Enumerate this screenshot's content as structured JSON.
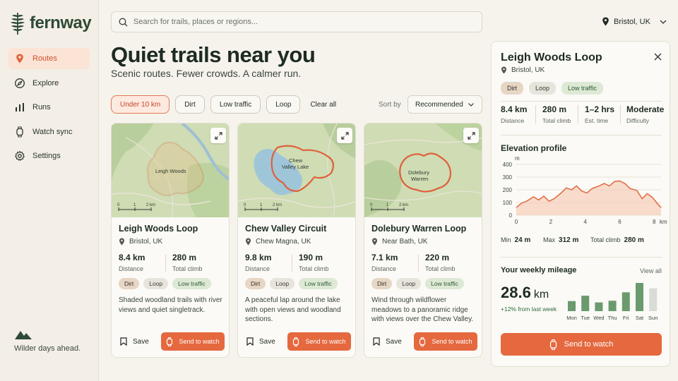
{
  "brand": {
    "name": "fernway",
    "tagline": "Wilder days ahead."
  },
  "nav": [
    {
      "label": "Routes",
      "icon": "location-pin-icon",
      "active": true
    },
    {
      "label": "Explore",
      "icon": "compass-icon",
      "active": false
    },
    {
      "label": "Runs",
      "icon": "bar-chart-icon",
      "active": false
    },
    {
      "label": "Watch sync",
      "icon": "watch-icon",
      "active": false
    },
    {
      "label": "Settings",
      "icon": "gear-icon",
      "active": false
    }
  ],
  "search": {
    "placeholder": "Search for trails, places or regions..."
  },
  "location": {
    "label": "Bristol, UK"
  },
  "header": {
    "title": "Quiet trails near you",
    "subtitle": "Scenic routes. Fewer crowds. A calmer run."
  },
  "filters": {
    "chips": [
      "Under 10 km",
      "Dirt",
      "Low traffic",
      "Loop"
    ],
    "active_index": 0,
    "clear_label": "Clear all"
  },
  "sort": {
    "label": "Sort by",
    "value": "Recommended"
  },
  "cards": [
    {
      "title": "Leigh Woods Loop",
      "location": "Bristol, UK",
      "distance": "8.4 km",
      "distance_label": "Distance",
      "climb": "280 m",
      "climb_label": "Total climb",
      "tags": [
        "Dirt",
        "Loop",
        "Low traffic"
      ],
      "description": "Shaded woodland trails with river views and quiet singletrack.",
      "map_label": "Leigh Woods",
      "save_label": "Save",
      "send_label": "Send to watch",
      "scale": [
        "0",
        "1",
        "2 km"
      ]
    },
    {
      "title": "Chew Valley Circuit",
      "location": "Chew Magna, UK",
      "distance": "9.8 km",
      "distance_label": "Distance",
      "climb": "190 m",
      "climb_label": "Total climb",
      "tags": [
        "Dirt",
        "Loop",
        "Low traffic"
      ],
      "description": "A peaceful lap around the lake with open views and woodland sections.",
      "map_label": "Chew Valley Lake",
      "save_label": "Save",
      "send_label": "Send to watch",
      "scale": [
        "0",
        "1",
        "2 km"
      ]
    },
    {
      "title": "Dolebury Warren Loop",
      "location": "Near Bath, UK",
      "distance": "7.1 km",
      "distance_label": "Distance",
      "climb": "220 m",
      "climb_label": "Total climb",
      "tags": [
        "Dirt",
        "Loop",
        "Low traffic"
      ],
      "description": "Wind through wildflower meadows to a panoramic ridge with views over the Chew Valley.",
      "map_label": "Dolebury Warren",
      "save_label": "Save",
      "send_label": "Send to watch",
      "scale": [
        "0",
        "1",
        "2 km"
      ]
    }
  ],
  "detail": {
    "title": "Leigh Woods Loop",
    "location": "Bristol, UK",
    "tags": [
      "Dirt",
      "Loop",
      "Low traffic"
    ],
    "stats": [
      {
        "value": "8.4 km",
        "label": "Distance"
      },
      {
        "value": "280 m",
        "label": "Total climb"
      },
      {
        "value": "1–2 hrs",
        "label": "Est. time"
      },
      {
        "value": "Moderate",
        "label": "Difficulty"
      }
    ],
    "elevation": {
      "heading": "Elevation profile",
      "y_unit": "m",
      "x_unit": "km",
      "min_label": "Min",
      "min_value": "24 m",
      "max_label": "Max",
      "max_value": "312 m",
      "total_label": "Total climb",
      "total_value": "280 m"
    },
    "mileage": {
      "heading": "Your weekly mileage",
      "view_all": "View all",
      "value": "28.6",
      "unit": "km",
      "change": "+12% from last week"
    },
    "send_label": "Send to watch"
  },
  "chart_data": [
    {
      "type": "area",
      "title": "Elevation profile",
      "ylabel": "m",
      "xlabel": "km",
      "ylim": [
        0,
        400
      ],
      "xlim": [
        0,
        8.4
      ],
      "yticks": [
        0,
        100,
        200,
        300,
        400
      ],
      "xticks": [
        0,
        2,
        4,
        6,
        8
      ],
      "x": [
        0,
        0.3,
        0.6,
        1.0,
        1.3,
        1.6,
        1.9,
        2.2,
        2.6,
        2.9,
        3.2,
        3.5,
        3.8,
        4.1,
        4.4,
        4.8,
        5.1,
        5.4,
        5.7,
        6.0,
        6.3,
        6.6,
        7.0,
        7.3,
        7.6,
        7.9,
        8.2,
        8.4
      ],
      "y": [
        60,
        95,
        110,
        145,
        120,
        150,
        110,
        130,
        175,
        215,
        200,
        230,
        190,
        175,
        210,
        230,
        250,
        230,
        265,
        270,
        250,
        210,
        195,
        130,
        170,
        140,
        90,
        60
      ]
    },
    {
      "type": "bar",
      "title": "Your weekly mileage",
      "categories": [
        "Mon",
        "Tue",
        "Wed",
        "Thu",
        "Fri",
        "Sat",
        "Sun"
      ],
      "values": [
        3.0,
        4.6,
        2.6,
        3.1,
        5.6,
        8.4,
        6.8
      ],
      "highlight": [
        true,
        true,
        true,
        true,
        true,
        true,
        false
      ]
    }
  ],
  "colors": {
    "accent": "#e5683f",
    "brand": "#2e4a36",
    "bar": "#6a9a6e",
    "bar_future": "#d9dcd4",
    "elev_line": "#e0704a",
    "elev_fill": "#f6cdb9"
  }
}
